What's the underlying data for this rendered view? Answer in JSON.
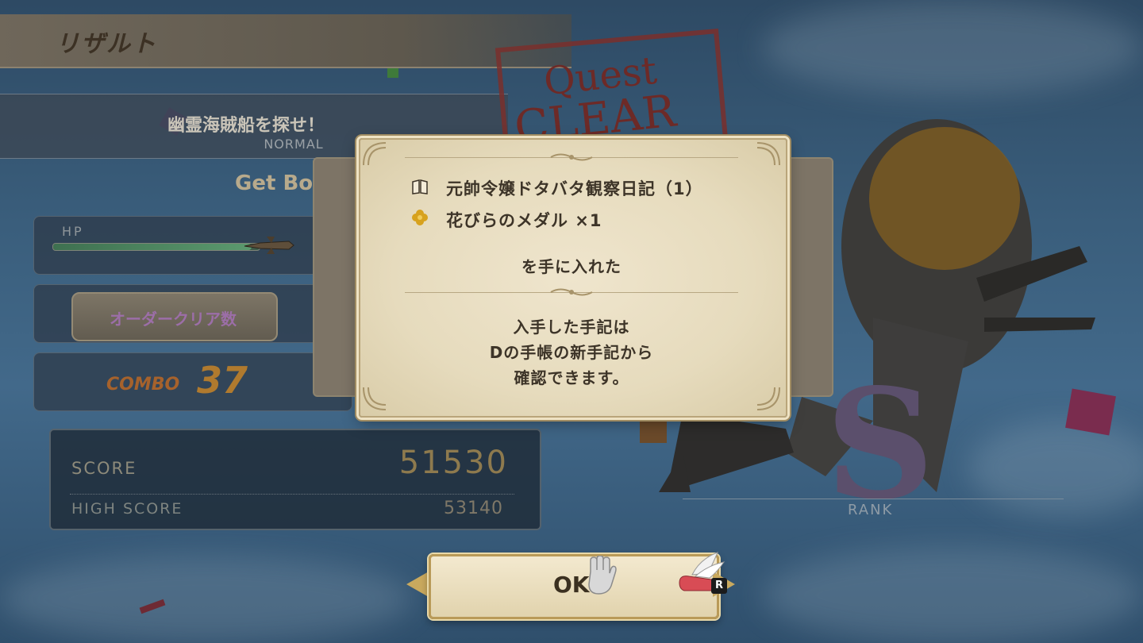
{
  "result_panel": {
    "title": "リザルト",
    "quest_name": "幽霊海賊船を探せ！",
    "difficulty": "NORMAL",
    "get_bonus_partial": "Get Bo",
    "hp_label": "HP",
    "order_clear_label": "オーダークリア数",
    "combo_label": "COMBO",
    "combo_value": "37",
    "score_label": "SCORE",
    "score_value": "51530",
    "high_score_label": "HIGH SCORE",
    "high_score_value": "53140"
  },
  "stamp": {
    "line1": "Quest",
    "line2": "CLEAR"
  },
  "rank": {
    "grade": "S",
    "label": "RANK"
  },
  "dialog": {
    "items": [
      {
        "icon": "book-icon",
        "text": "元帥令嬢ドタバタ観察日記（1）"
      },
      {
        "icon": "petal-medal-icon",
        "text": "花びらのメダル ×1"
      }
    ],
    "obtained_text": "を手に入れた",
    "info_lines": [
      "入手した手記は",
      "Dの手帳の新手記から",
      "確認できます。"
    ]
  },
  "back_panel": {
    "paren": ")"
  },
  "ok_button": {
    "label": "OK",
    "shortcut": "R"
  },
  "colors": {
    "parchment": "#e6dbbd",
    "gold_border": "#b99a58",
    "stamp_red": "#7a2f2b"
  }
}
